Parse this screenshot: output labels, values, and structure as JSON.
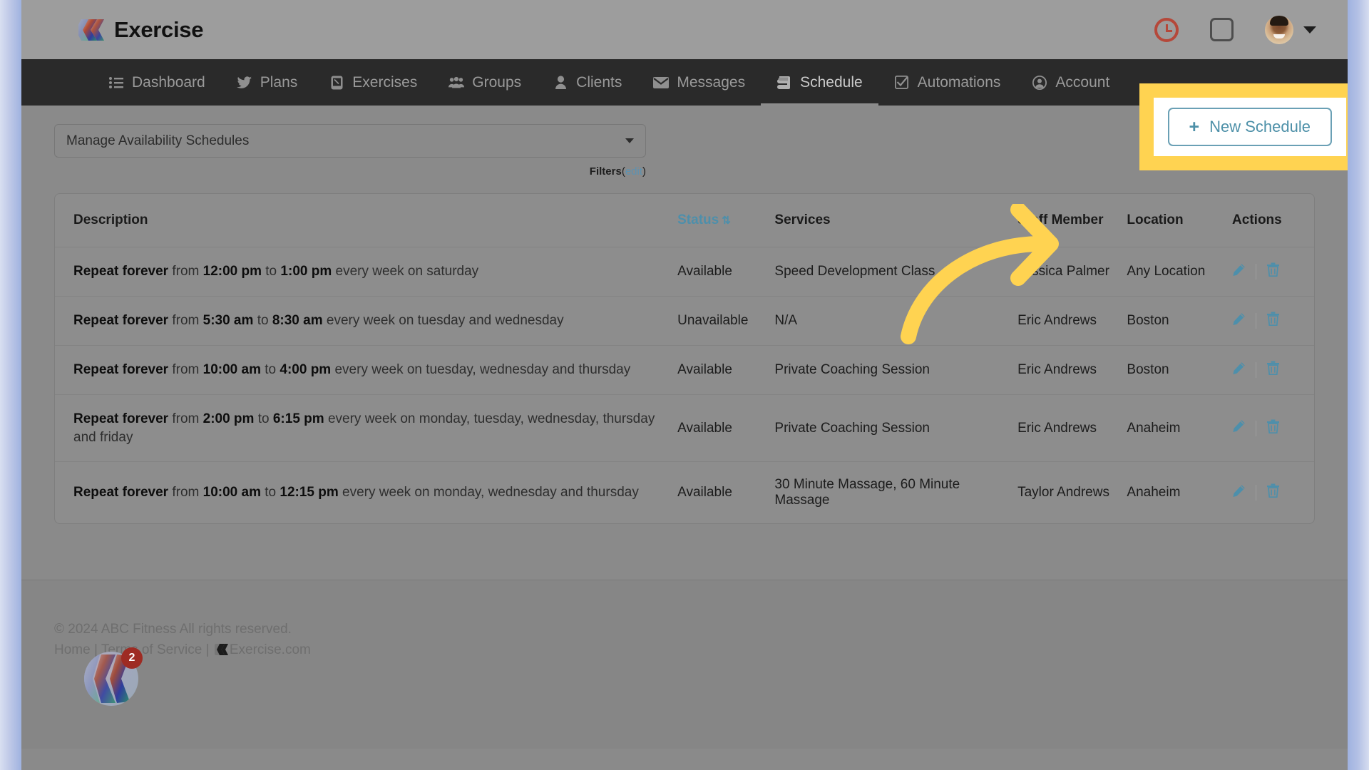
{
  "header": {
    "brand": "Exercise",
    "clock_icon": "clock-icon",
    "square_icon": "square-icon",
    "avatar_icon": "user-avatar",
    "chevron_icon": "chevron-down-icon"
  },
  "nav": {
    "items": [
      {
        "label": "Dashboard",
        "icon": "list-icon",
        "active": false
      },
      {
        "label": "Plans",
        "icon": "twitter-icon",
        "active": false
      },
      {
        "label": "Exercises",
        "icon": "phone-icon",
        "active": false
      },
      {
        "label": "Groups",
        "icon": "users-icon",
        "active": false
      },
      {
        "label": "Clients",
        "icon": "person-icon",
        "active": false
      },
      {
        "label": "Messages",
        "icon": "envelope-icon",
        "active": false
      },
      {
        "label": "Schedule",
        "icon": "book-icon",
        "active": true
      },
      {
        "label": "Automations",
        "icon": "check-box-icon",
        "active": false
      },
      {
        "label": "Account",
        "icon": "account-icon",
        "active": false
      }
    ]
  },
  "toolbar": {
    "schedule_select_value": "Manage Availability Schedules",
    "filters_label": "Filters",
    "filters_edit": "edit",
    "filters_open_paren": "(",
    "filters_close_paren": ")",
    "new_schedule_label": "New Schedule",
    "new_schedule_plus": "+"
  },
  "table": {
    "columns": [
      {
        "key": "description",
        "label": "Description",
        "sortable": false
      },
      {
        "key": "status",
        "label": "Status",
        "sortable": true
      },
      {
        "key": "services",
        "label": "Services",
        "sortable": false
      },
      {
        "key": "staff",
        "label": "Staff Member",
        "sortable": false
      },
      {
        "key": "location",
        "label": "Location",
        "sortable": false
      },
      {
        "key": "actions",
        "label": "Actions",
        "sortable": false
      }
    ],
    "sort_icon": "sort-updown-icon",
    "rows": [
      {
        "repeat": "Repeat forever",
        "from_word": "from",
        "start": "12:00 pm",
        "to_word": "to",
        "end": "1:00 pm",
        "recurrence": "every week on saturday",
        "status": "Available",
        "services": "Speed Development Class",
        "staff": "Jessica Palmer",
        "location": "Any Location"
      },
      {
        "repeat": "Repeat forever",
        "from_word": "from",
        "start": "5:30 am",
        "to_word": "to",
        "end": "8:30 am",
        "recurrence": "every week on tuesday and wednesday",
        "status": "Unavailable",
        "services": "N/A",
        "staff": "Eric Andrews",
        "location": "Boston"
      },
      {
        "repeat": "Repeat forever",
        "from_word": "from",
        "start": "10:00 am",
        "to_word": "to",
        "end": "4:00 pm",
        "recurrence": "every week on tuesday, wednesday and thursday",
        "status": "Available",
        "services": "Private Coaching Session",
        "staff": "Eric Andrews",
        "location": "Boston"
      },
      {
        "repeat": "Repeat forever",
        "from_word": "from",
        "start": "2:00 pm",
        "to_word": "to",
        "end": "6:15 pm",
        "recurrence": "every week on monday, tuesday, wednesday, thursday and friday",
        "status": "Available",
        "services": "Private Coaching Session",
        "staff": "Eric Andrews",
        "location": "Anaheim"
      },
      {
        "repeat": "Repeat forever",
        "from_word": "from",
        "start": "10:00 am",
        "to_word": "to",
        "end": "12:15 pm",
        "recurrence": "every week on monday, wednesday and thursday",
        "status": "Available",
        "services": "30 Minute Massage, 60 Minute Massage",
        "staff": "Taylor Andrews",
        "location": "Anaheim"
      }
    ],
    "row_actions": {
      "edit_icon": "pencil-icon",
      "delete_icon": "trash-icon"
    }
  },
  "footer": {
    "copyright": "© 2024 ABC Fitness All rights reserved.",
    "home": "Home",
    "sep1": " | ",
    "terms": "Terms of Service",
    "sep2": " | ",
    "exercise_com": "Exercise.com"
  },
  "chat_widget": {
    "badge_count": "2",
    "icon": "chat-bubble-logo-icon"
  },
  "annotation": {
    "arrow_icon": "curved-arrow-icon",
    "highlight_color": "#ffd351"
  },
  "colors": {
    "accent_teal": "#4d8fab",
    "nav_bg": "#2a2a2a",
    "header_bg": "#9d9d9d",
    "highlight_yellow": "#ffd351",
    "badge_red": "#9e2b23"
  }
}
